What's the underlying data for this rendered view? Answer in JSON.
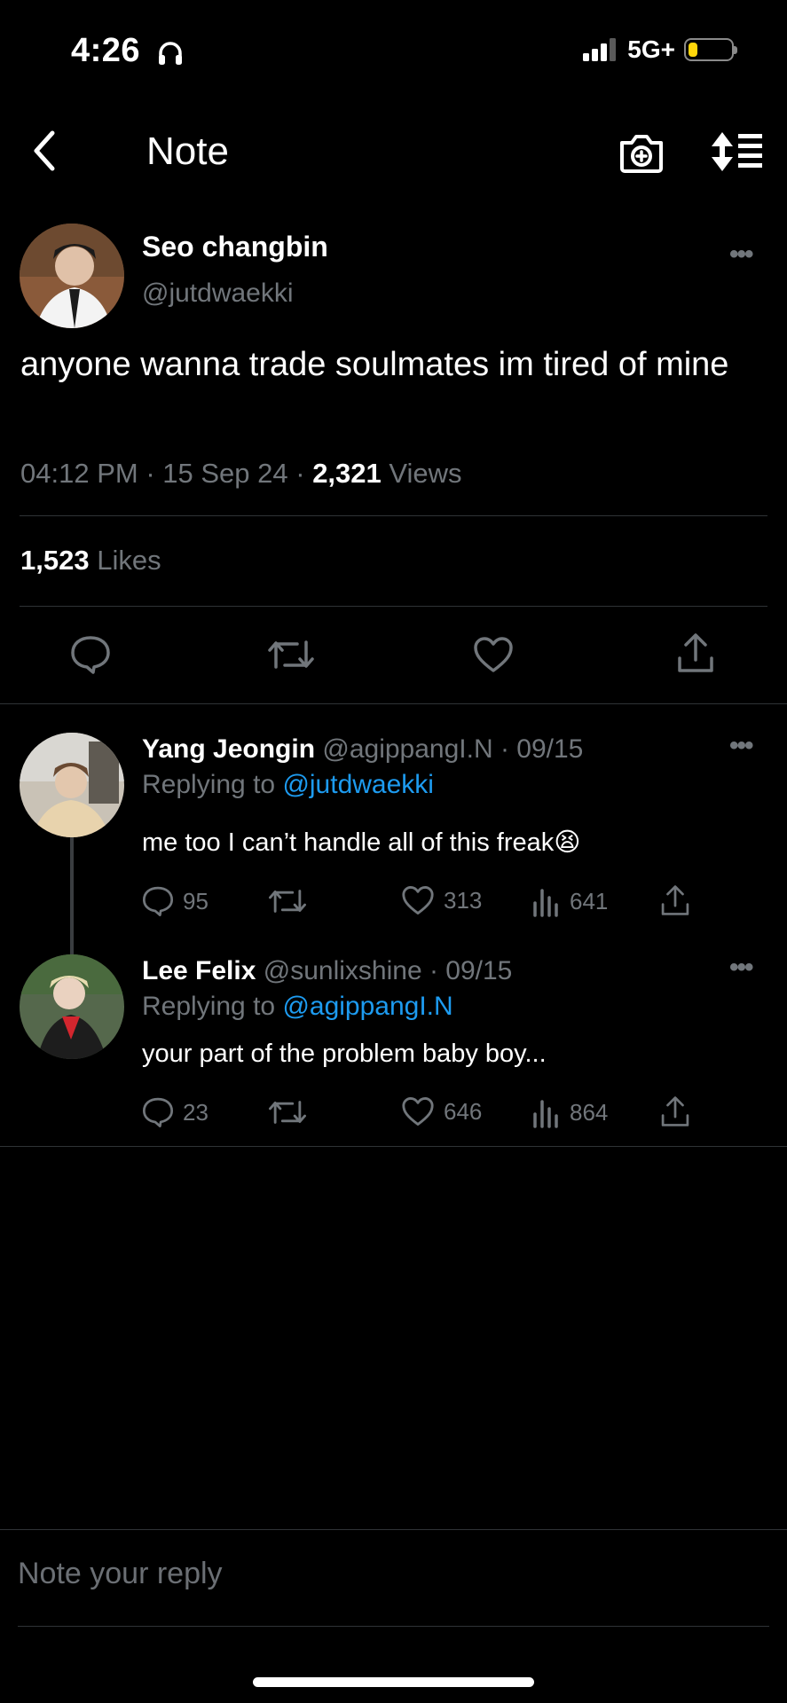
{
  "status_bar": {
    "time": "4:26",
    "network": "5G+",
    "battery_level": 0.22,
    "battery_color": "#ffd60a"
  },
  "header": {
    "title": "Note"
  },
  "tweet": {
    "author_name": "Seo changbin",
    "author_handle": "@jutdwaekki",
    "text": "anyone wanna trade soulmates im tired of mine",
    "time": "04:12 PM",
    "date": "15 Sep 24",
    "views_count": "2,321",
    "views_label": "Views",
    "likes_count": "1,523",
    "likes_label": "Likes"
  },
  "replies": [
    {
      "name": "Yang Jeongin",
      "handle_date": "@agippangI.N · 09/15",
      "replying_label": "Replying to",
      "replying_to": "@jutdwaekki",
      "text": "me too I can’t handle all of this freak",
      "emoji": "😫",
      "comments": "95",
      "likes": "313",
      "views": "641"
    },
    {
      "name": "Lee Felix",
      "handle_date": "@sunlixshine · 09/15",
      "replying_label": "Replying to",
      "replying_to": "@agippangI.N",
      "text": "your part of the problem baby boy...",
      "comments": "23",
      "likes": "646",
      "views": "864"
    }
  ],
  "reply_input": {
    "placeholder": "Note your reply"
  },
  "colors": {
    "background": "#000000",
    "secondary_text": "#71767b",
    "link": "#1d9bf0",
    "divider": "#2f3336"
  }
}
